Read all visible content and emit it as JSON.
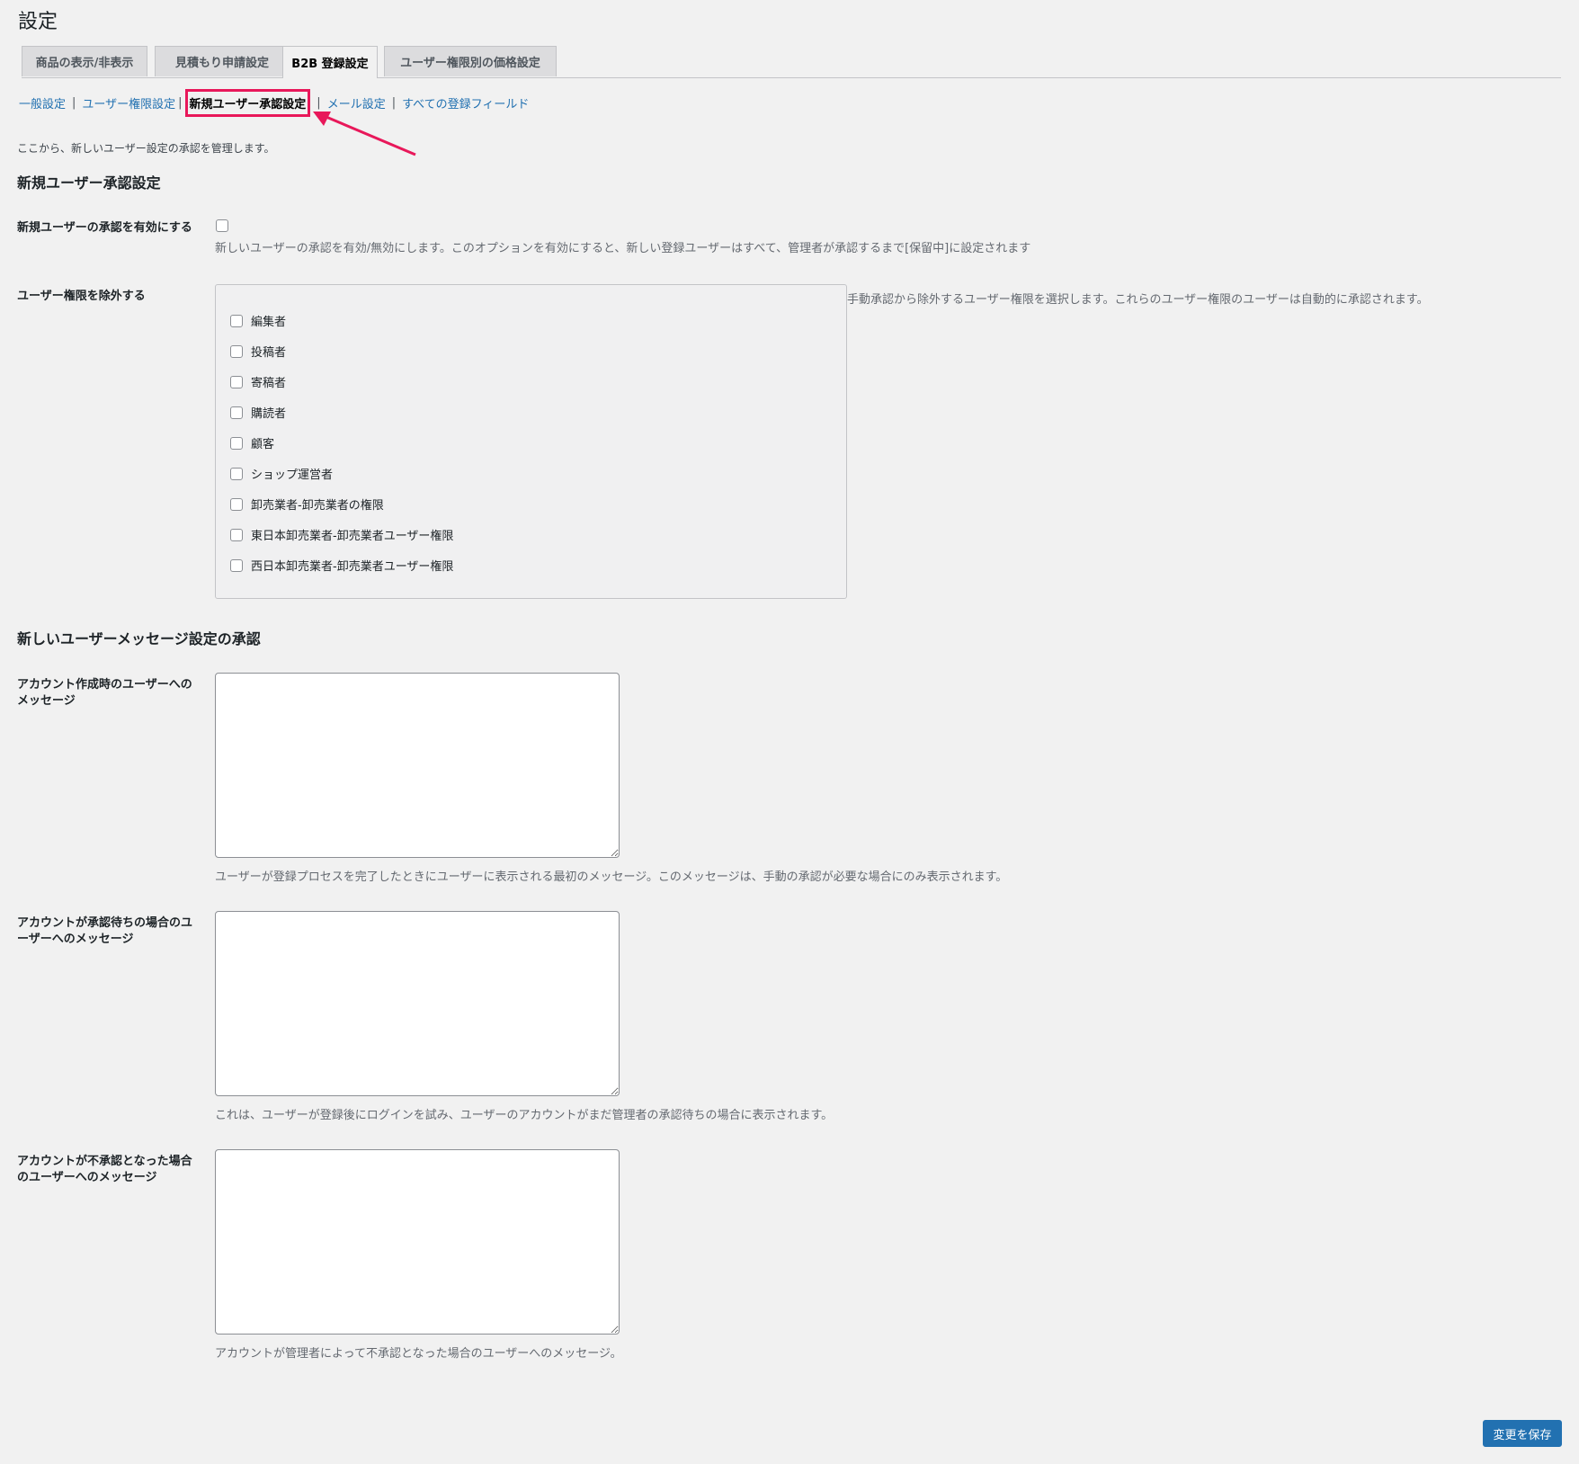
{
  "page": {
    "title": "設定"
  },
  "tabs": [
    {
      "label": "商品の表示/非表示",
      "active": false
    },
    {
      "label": "見積もり申請設定",
      "active": false
    },
    {
      "label": "B2B 登録設定",
      "active": true
    },
    {
      "label": "ユーザー権限別の価格設定",
      "active": false
    }
  ],
  "subnav": [
    {
      "label": "一般設定"
    },
    {
      "label": "ユーザー権限設定"
    },
    {
      "label": "新規ユーザー承認設定",
      "current": true
    },
    {
      "label": "メール設定"
    },
    {
      "label": "すべての登録フィールド"
    }
  ],
  "subnav_separator": "|",
  "intro": "ここから、新しいユーザー設定の承認を管理します。",
  "section1": {
    "heading": "新規ユーザー承認設定",
    "enable": {
      "label": "新規ユーザーの承認を有効にする",
      "checked": false,
      "description": "新しいユーザーの承認を有効/無効にします。このオプションを有効にすると、新しい登録ユーザーはすべて、管理者が承認するまで[保留中]に設定されます"
    },
    "exclude": {
      "label": "ユーザー権限を除外する",
      "description": "手動承認から除外するユーザー権限を選択します。これらのユーザー権限のユーザーは自動的に承認されます。",
      "roles": [
        {
          "label": "編集者",
          "checked": false
        },
        {
          "label": "投稿者",
          "checked": false
        },
        {
          "label": "寄稿者",
          "checked": false
        },
        {
          "label": "購読者",
          "checked": false
        },
        {
          "label": "顧客",
          "checked": false
        },
        {
          "label": "ショップ運営者",
          "checked": false
        },
        {
          "label": "卸売業者-卸売業者の権限",
          "checked": false
        },
        {
          "label": "東日本卸売業者-卸売業者ユーザー権限",
          "checked": false
        },
        {
          "label": "西日本卸売業者-卸売業者ユーザー権限",
          "checked": false
        }
      ]
    }
  },
  "section2": {
    "heading": "新しいユーザーメッセージ設定の承認",
    "fields": [
      {
        "label": "アカウント作成時のユーザーへのメッセージ",
        "value": "",
        "description": "ユーザーが登録プロセスを完了したときにユーザーに表示される最初のメッセージ。このメッセージは、手動の承認が必要な場合にのみ表示されます。"
      },
      {
        "label": "アカウントが承認待ちの場合のユーザーへのメッセージ",
        "value": "",
        "description": "これは、ユーザーが登録後にログインを試み、ユーザーのアカウントがまだ管理者の承認待ちの場合に表示されます。"
      },
      {
        "label": "アカウントが不承認となった場合のユーザーへのメッセージ",
        "value": "",
        "description": "アカウントが管理者によって不承認となった場合のユーザーへのメッセージ。"
      }
    ]
  },
  "save_button": "変更を保存",
  "colors": {
    "accent": "#2271b1",
    "highlight": "#e8185a",
    "background": "#f1f1f1"
  }
}
